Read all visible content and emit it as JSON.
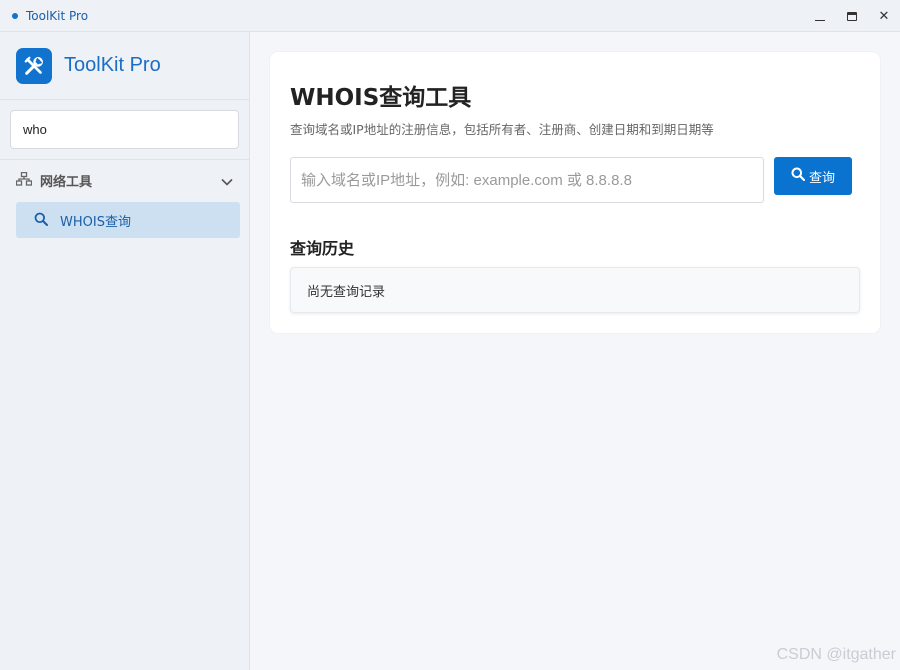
{
  "window": {
    "title": "ToolKit Pro"
  },
  "sidebar": {
    "brand_name": "ToolKit Pro",
    "search_value": "who",
    "group_label": "网络工具",
    "items": [
      {
        "label": "WHOIS查询"
      }
    ]
  },
  "main": {
    "title": "WHOIS查询工具",
    "description": "查询域名或IP地址的注册信息，包括所有者、注册商、创建日期和到期日期等",
    "input_placeholder": "输入域名或IP地址，例如: example.com 或 8.8.8.8",
    "query_button_label": "查询",
    "history_title": "查询历史",
    "history_empty": "尚无查询记录"
  },
  "watermark": "CSDN @itgather",
  "colors": {
    "accent": "#0a73cf",
    "selected_bg": "#cde0f1"
  }
}
